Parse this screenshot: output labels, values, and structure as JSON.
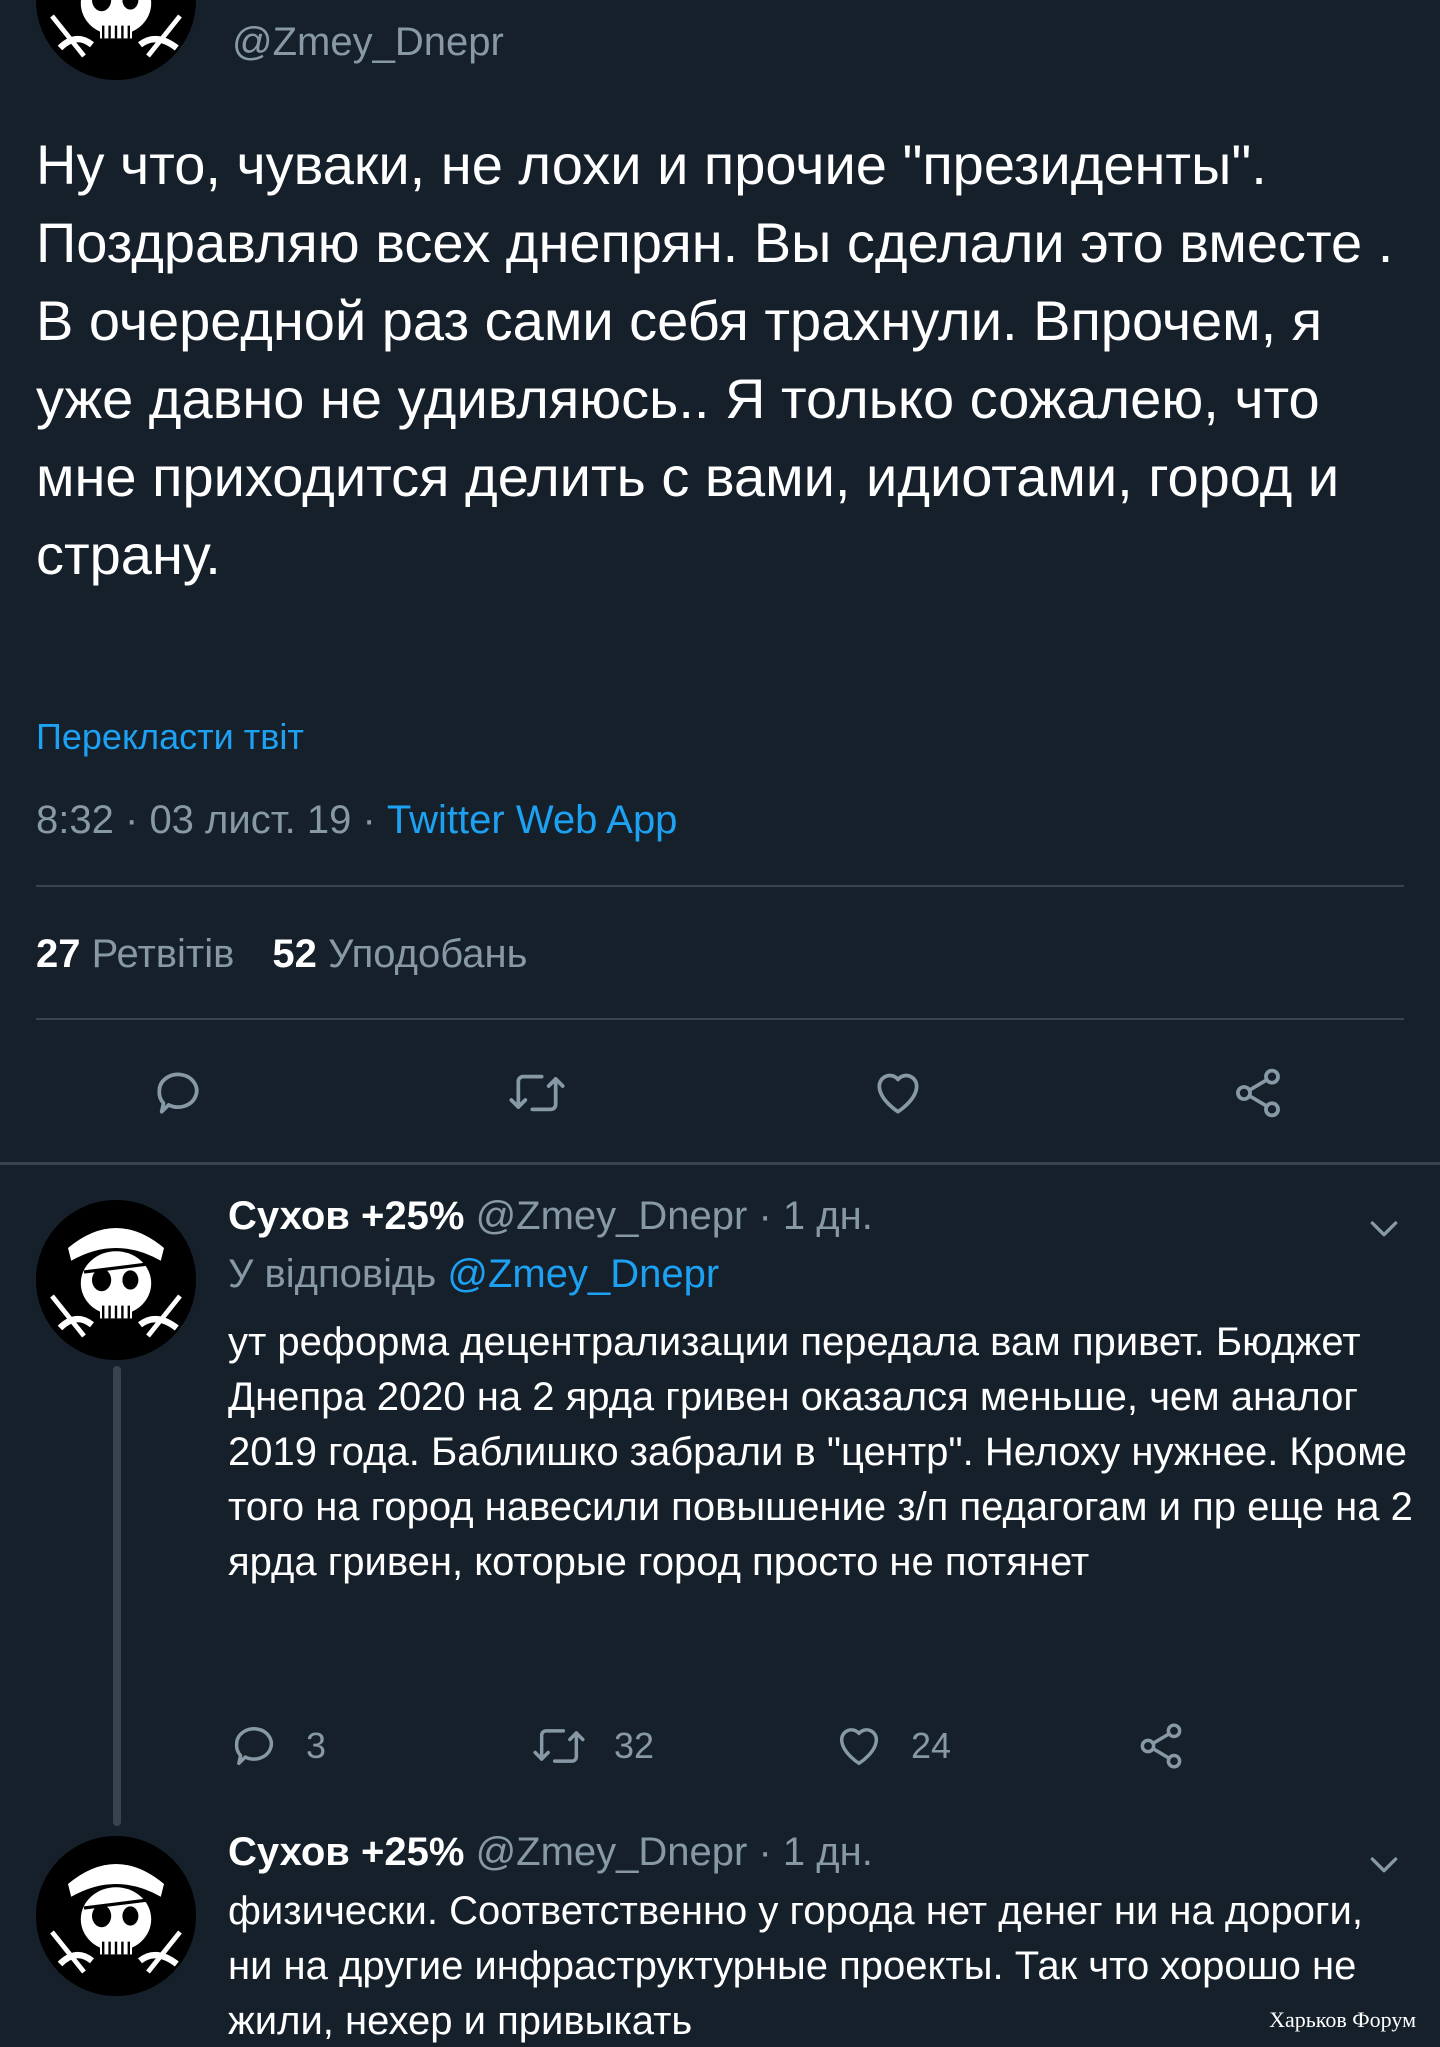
{
  "main_tweet": {
    "handle": "@Zmey_Dnepr",
    "text": "Ну что, чуваки, не лохи и прочие \"президенты\". Поздравляю всех днепрян. Вы сделали это вместе . В очередной раз сами себя трахнули. Впрочем, я уже давно не удивляюсь.. Я только сожалею, что мне приходится делить с вами, идиотами, город и страну.",
    "translate_label": "Перекласти твіт",
    "time": "8:32",
    "date": "03 лист. 19",
    "separator": "·",
    "source_app": "Twitter Web App",
    "retweets_count": "27",
    "retweets_label": "Ретвітів",
    "likes_count": "52",
    "likes_label": "Уподобань",
    "actions": [
      "reply-icon",
      "retweet-icon",
      "like-icon",
      "share-icon"
    ]
  },
  "replies": [
    {
      "name": "Сухов +25%",
      "handle": "@Zmey_Dnepr",
      "time": "· 1 дн.",
      "reply_to_label": "У відповідь",
      "reply_to_handle": "@Zmey_Dnepr",
      "text": "ут реформа децентрализации передала вам привет. Бюджет Днепра 2020 на 2 ярда гривен оказался меньше, чем аналог 2019 года. Баблишко забрали в \"центр\". Нелоху нужнее. Кроме того на город навесили повышение з/п педагогам и пр еще на 2 ярда гривен, которые город просто не потянет",
      "reply_count": "3",
      "retweet_count": "32",
      "like_count": "24"
    },
    {
      "name": "Сухов +25%",
      "handle": "@Zmey_Dnepr",
      "time": "· 1 дн.",
      "text": "физически. Соответственно у города нет денег ни на дороги, ни на другие инфраструктурные проекты. Так что хорошо не жили, нехер и привыкать"
    }
  ],
  "watermark": "Харьков Форум",
  "colors": {
    "background": "#15202b",
    "accent": "#1da1f2",
    "muted": "#8899a6",
    "divider": "#38444d"
  }
}
